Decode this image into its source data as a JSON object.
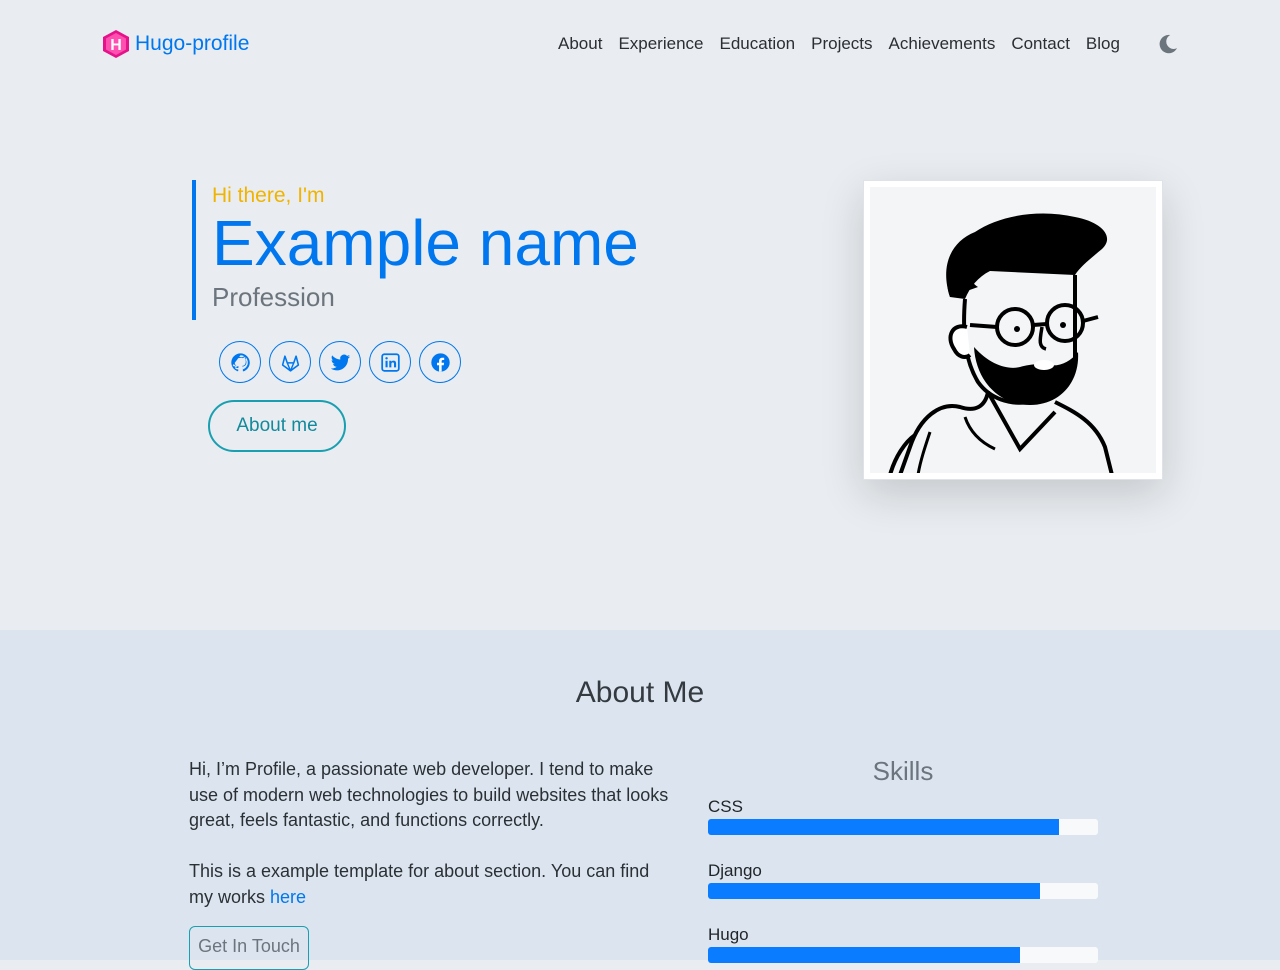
{
  "navbar": {
    "brand": "Hugo-profile",
    "brand_logo_letter": "H",
    "links": [
      "About",
      "Experience",
      "Education",
      "Projects",
      "Achievements",
      "Contact",
      "Blog"
    ],
    "theme_icon": "moon-icon"
  },
  "hero": {
    "greeting": "Hi there, I'm",
    "name": "Example name",
    "profession": "Profession",
    "socials": [
      "github-icon",
      "gitlab-icon",
      "twitter-icon",
      "linkedin-icon",
      "facebook-icon"
    ],
    "about_button": "About me",
    "avatar": "avatar-illustration"
  },
  "about": {
    "title": "About Me",
    "paragraph1": "Hi, I’m Profile, a passionate web developer. I tend to make use of modern web technologies to build websites that looks great, feels fantastic, and functions correctly.",
    "paragraph2_prefix": "This is a example template for about section. You can find my works ",
    "paragraph2_link": "here",
    "get_in_touch": "Get In Touch",
    "skills_title": "Skills",
    "skills": [
      {
        "name": "CSS",
        "percent": 90
      },
      {
        "name": "Django",
        "percent": 85
      },
      {
        "name": "Hugo",
        "percent": 80
      }
    ]
  },
  "colors": {
    "accent": "#0077ee",
    "greeting": "#f0b400",
    "teal": "#1a9fb0",
    "page_bg": "#e9edf1",
    "about_bg": "#dce5ef"
  }
}
